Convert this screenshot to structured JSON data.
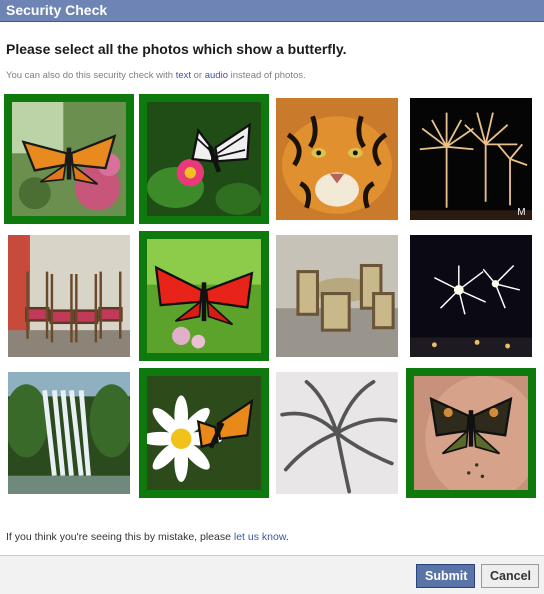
{
  "dialog": {
    "title": "Security Check",
    "heading": "Please select all the photos which show a butterfly.",
    "subtext_before": "You can also do this security check with ",
    "subtext_text": "text",
    "subtext_or": " or ",
    "subtext_audio": "audio",
    "subtext_after": " instead of photos.",
    "mistake_before": "If you think you're seeing this by mistake, please ",
    "mistake_link": "let us know",
    "mistake_after": "."
  },
  "photos": [
    {
      "subject": "butterfly-on-flowers",
      "selected": true
    },
    {
      "subject": "butterfly-on-pink-flower",
      "selected": true
    },
    {
      "subject": "tiger",
      "selected": false
    },
    {
      "subject": "fireworks",
      "selected": false
    },
    {
      "subject": "chairs",
      "selected": false
    },
    {
      "subject": "red-butterfly",
      "selected": true
    },
    {
      "subject": "dining-chairs",
      "selected": false
    },
    {
      "subject": "fireworks-city",
      "selected": false
    },
    {
      "subject": "waterfall",
      "selected": false
    },
    {
      "subject": "butterfly-on-daisy",
      "selected": true
    },
    {
      "subject": "palm-tree-sketch",
      "selected": false
    },
    {
      "subject": "butterfly-tattoo",
      "selected": true
    }
  ],
  "buttons": {
    "submit": "Submit",
    "cancel": "Cancel"
  },
  "colors": {
    "titlebar": "#6d84b4",
    "selection_border": "#0e7a0e",
    "link": "#3b5998"
  }
}
